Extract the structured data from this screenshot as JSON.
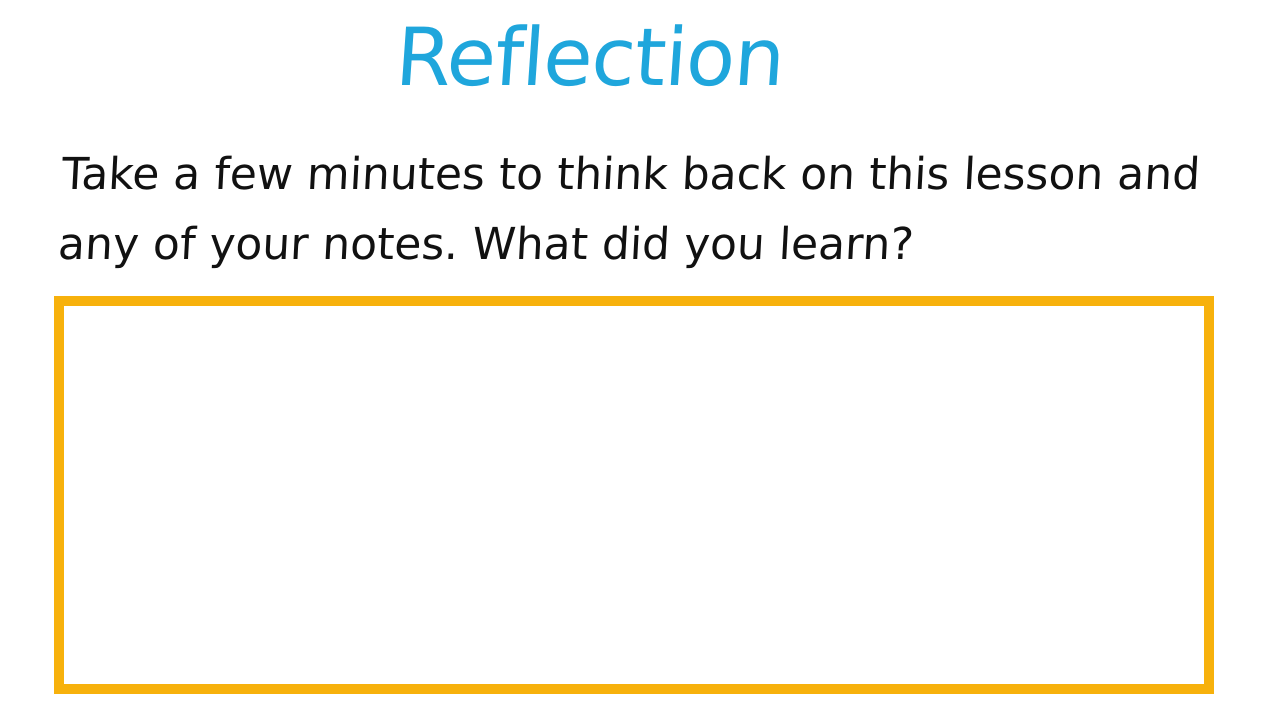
{
  "page": {
    "title": "Reflection",
    "prompt": "Take a few minutes to think back on this lesson and any of your notes. What did you learn?"
  },
  "answer_box": {
    "value": ""
  },
  "colors": {
    "title": "#1fa6dc",
    "text": "#111111",
    "box_border": "#f7b10c",
    "background": "#ffffff"
  }
}
